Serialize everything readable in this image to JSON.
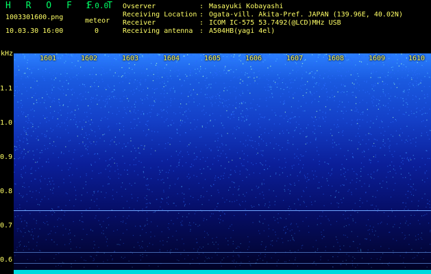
{
  "header": {
    "app_name": "H R O F F T",
    "version": "1.0.0",
    "filename": "1003301600.png",
    "datetime": "10.03.30 16:00",
    "meteor_label": "meteor",
    "meteor_count": "0"
  },
  "info": [
    {
      "key": "Ovserver",
      "value": "Masayuki Kobayashi"
    },
    {
      "key": "Receiving Location",
      "value": "Ogata-vill. Akita-Pref. JAPAN (139.96E, 40.02N)"
    },
    {
      "key": "Receiver",
      "value": "ICOM IC-575 53.7492(@LCD)MHz USB"
    },
    {
      "key": "Receiving antenna",
      "value": "A504HB(yagi 4el)"
    }
  ],
  "plot": {
    "y_unit": "kHz",
    "y_ticks": [
      "1.1",
      "1.0",
      "0.9",
      "0.8",
      "0.7",
      "0.6"
    ],
    "x_ticks": [
      "1601",
      "1602",
      "1603",
      "1604",
      "1605",
      "1606",
      "1607",
      "1608",
      "1609",
      "1610"
    ],
    "colors": {
      "line": "#6fa8ff",
      "bright": "#00ffff"
    }
  }
}
